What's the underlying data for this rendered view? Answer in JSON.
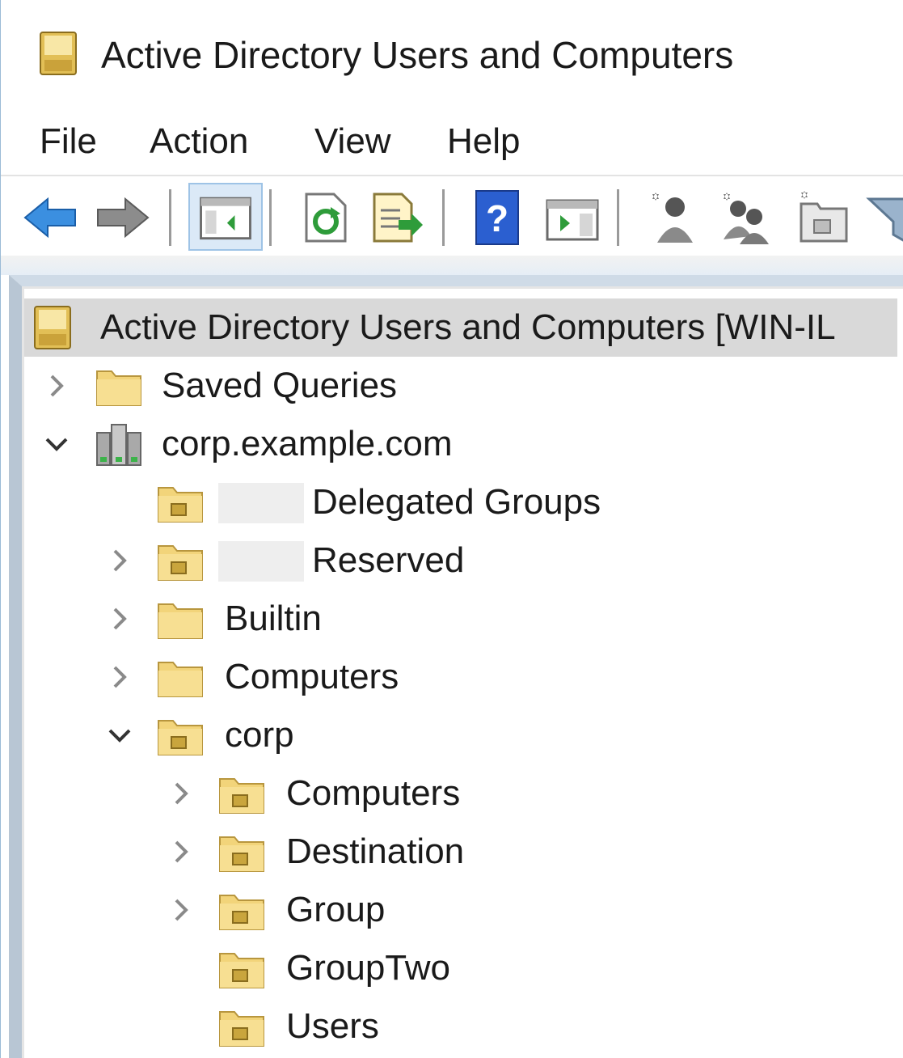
{
  "window": {
    "title": "Active Directory Users and Computers"
  },
  "menu": [
    "File",
    "Action",
    "View",
    "Help"
  ],
  "toolbar": {
    "buttons": [
      {
        "name": "back-arrow-icon"
      },
      {
        "name": "forward-arrow-icon"
      },
      {
        "name": "show-hide-console-tree-icon",
        "active": true
      },
      {
        "name": "refresh-icon"
      },
      {
        "name": "export-list-icon"
      },
      {
        "name": "help-icon"
      },
      {
        "name": "show-action-pane-icon"
      },
      {
        "name": "create-user-icon"
      },
      {
        "name": "create-group-icon"
      },
      {
        "name": "create-ou-icon"
      },
      {
        "name": "filter-icon"
      }
    ]
  },
  "tree": {
    "root": "Active Directory Users and Computers [WIN-IL",
    "saved_queries": "Saved Queries",
    "domain": "corp.example.com",
    "delegated_groups": "Delegated Groups",
    "reserved": "Reserved",
    "builtin": "Builtin",
    "computers": "Computers",
    "corp": "corp",
    "corp_computers": "Computers",
    "destination": "Destination",
    "group": "Group",
    "group_two": "GroupTwo",
    "users": "Users"
  },
  "colors": {
    "folder": "#f2d47a",
    "selection": "#d9d9d9",
    "accent": "#2a7fd4"
  }
}
